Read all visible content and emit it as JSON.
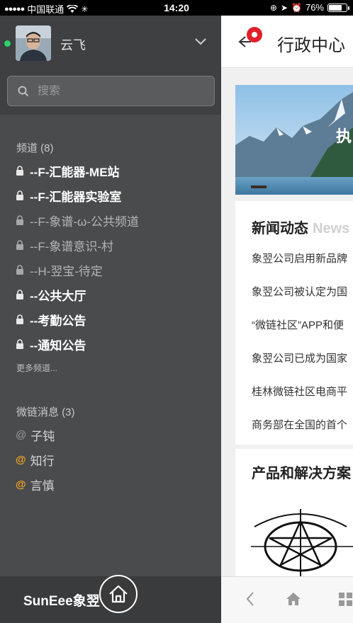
{
  "status_bar": {
    "carrier": "中国联通",
    "time": "14:20",
    "battery": "76%",
    "battery_level": 0.76
  },
  "sidebar": {
    "user": {
      "name": "云飞",
      "online": true
    },
    "search": {
      "placeholder": "搜索"
    },
    "channels_title": "频道 (8)",
    "channels": [
      {
        "label": "--F-汇能器-ME站",
        "unread": true
      },
      {
        "label": "--F-汇能器实验室",
        "unread": true
      },
      {
        "label": "--F-象谱-ω-公共频道",
        "unread": false
      },
      {
        "label": "--F-象谱意识-村",
        "unread": false
      },
      {
        "label": "--H-翌宝-待定",
        "unread": false
      },
      {
        "label": "--公共大厅",
        "unread": true
      },
      {
        "label": "--考勤公告",
        "unread": true
      },
      {
        "label": "--通知公告",
        "unread": true
      }
    ],
    "more_channels": "更多频道...",
    "messages_title": "微链消息 (3)",
    "messages": [
      {
        "label": "子钝",
        "highlight": false
      },
      {
        "label": "知行",
        "highlight": true
      },
      {
        "label": "言慎",
        "highlight": true
      }
    ],
    "logo": "SunEee象翌"
  },
  "content": {
    "title": "行政中心",
    "banner_text": "执",
    "news": {
      "title": "新闻动态",
      "subtitle": "News",
      "items": [
        "象翌公司启用新品牌",
        "象翌公司被认定为国",
        "“微链社区”APP和便",
        "象翌公司已成为国家",
        "桂林微链社区电商平",
        "商务部在全国的首个"
      ]
    },
    "products": {
      "title": "产品和解决方案"
    }
  },
  "colors": {
    "sidebar_bg": "#4a4b4d",
    "online": "#2ed16a",
    "badge": "#e0202a",
    "mention": "#f5a623"
  }
}
